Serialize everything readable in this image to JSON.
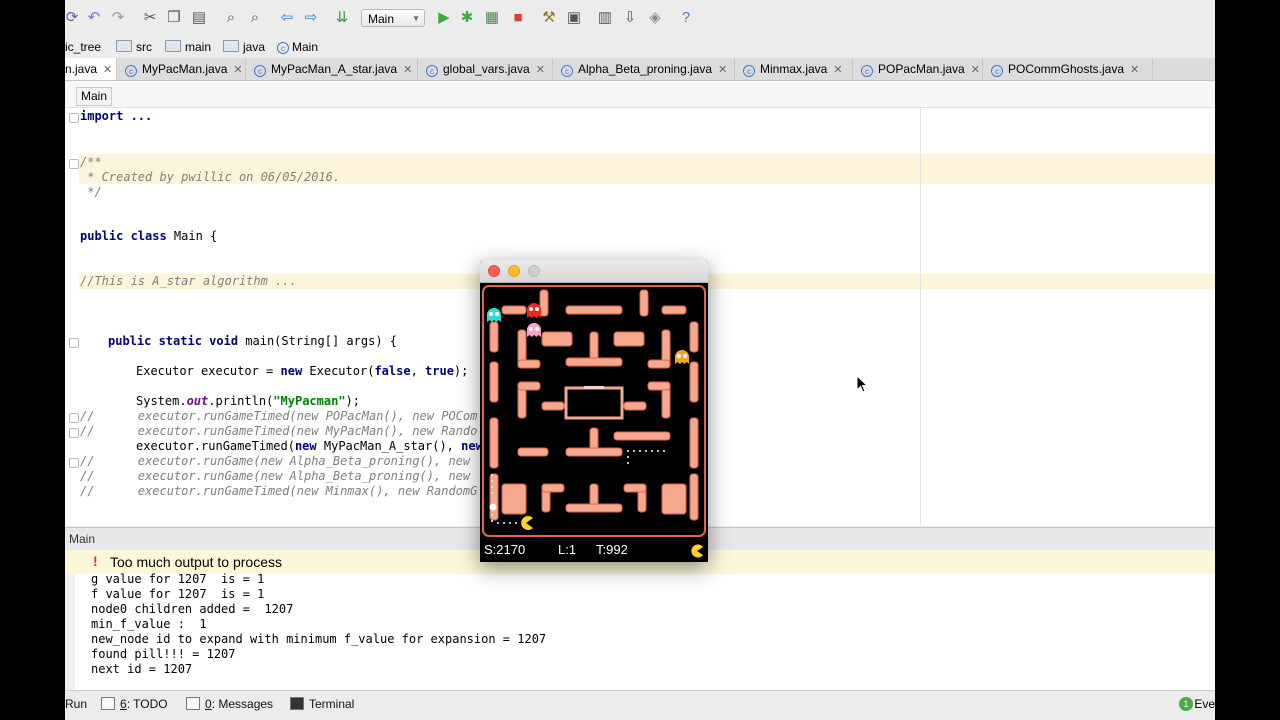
{
  "toolbar": {
    "run_config": "Main"
  },
  "breadcrumb": {
    "items": [
      "ic_tree",
      "src",
      "main",
      "java",
      "Main"
    ]
  },
  "tabs": [
    {
      "label": "n.java",
      "active": true
    },
    {
      "label": "MyPacMan.java"
    },
    {
      "label": "MyPacMan_A_star.java"
    },
    {
      "label": "global_vars.java"
    },
    {
      "label": "Alpha_Beta_proning.java"
    },
    {
      "label": "Minmax.java"
    },
    {
      "label": "POPacMan.java"
    },
    {
      "label": "POCommGhosts.java"
    }
  ],
  "nav_label": "Main",
  "code": {
    "import": "import ...",
    "javadoc_open": "/**",
    "javadoc_body": " * Created by pwillic on 06/05/2016.",
    "javadoc_close": " */",
    "class_decl_kw": "public class",
    "class_decl_rest": " Main {",
    "comment_astar": "//This is A_star algorithm ...",
    "main_kw": "public static void",
    "main_rest": " main(String[] args) {",
    "executor_pre": "Executor executor = ",
    "executor_new": "new",
    "executor_mid": " Executor(",
    "executor_false": "false",
    "executor_sep": ", ",
    "executor_true": "true",
    "executor_end": ");",
    "println_pre": "System.",
    "println_out": "out",
    "println_mid": ".println(",
    "println_str": "\"MyPacman\"",
    "println_end": ");",
    "c1": "//      executor.runGameTimed(new POPacMan(), new POCom",
    "c2": "//      executor.runGameTimed(new MyPacMan(), new Rando",
    "run_pre": "executor.runGameTimed(",
    "run_new": "new",
    "run_mid": " MyPacMan_A_star(), ",
    "run_new2": "new",
    "c3": "//      executor.runGame(new Alpha_Beta_proning(), new",
    "c4": "//      executor.runGame(new Alpha_Beta_proning(), new",
    "c5": "//      executor.runGameTimed(new Minmax(), new RandomG"
  },
  "run_panel": {
    "title": "Main",
    "warning": "Too much output to process",
    "warning_mark": "!"
  },
  "console_lines": [
    "g value for 1207  is = 1",
    "f value for 1207  is = 1",
    "node0 children added =  1207",
    "min_f_value :  1",
    "new_node id to expand with minimum f_value for expansion = 1207",
    "found pill!!! = 1207",
    "next id = 1207"
  ],
  "bottom_bar": {
    "run": "Run",
    "todo_num": "6",
    "todo": ": TODO",
    "messages_num": "0",
    "messages": ": Messages",
    "terminal": "Terminal",
    "event_count": "1",
    "event_label": "Eve"
  },
  "game": {
    "score": "S:2170",
    "level": "L:1",
    "time": "T:992",
    "colors": {
      "wall": "#f4a98f",
      "wall_edge": "#e0644a",
      "blinky": "#e8291c",
      "pinky": "#f7a1cf",
      "inky": "#34d8d8",
      "sue": "#f5a623",
      "pacman": "#ffd21f"
    }
  }
}
